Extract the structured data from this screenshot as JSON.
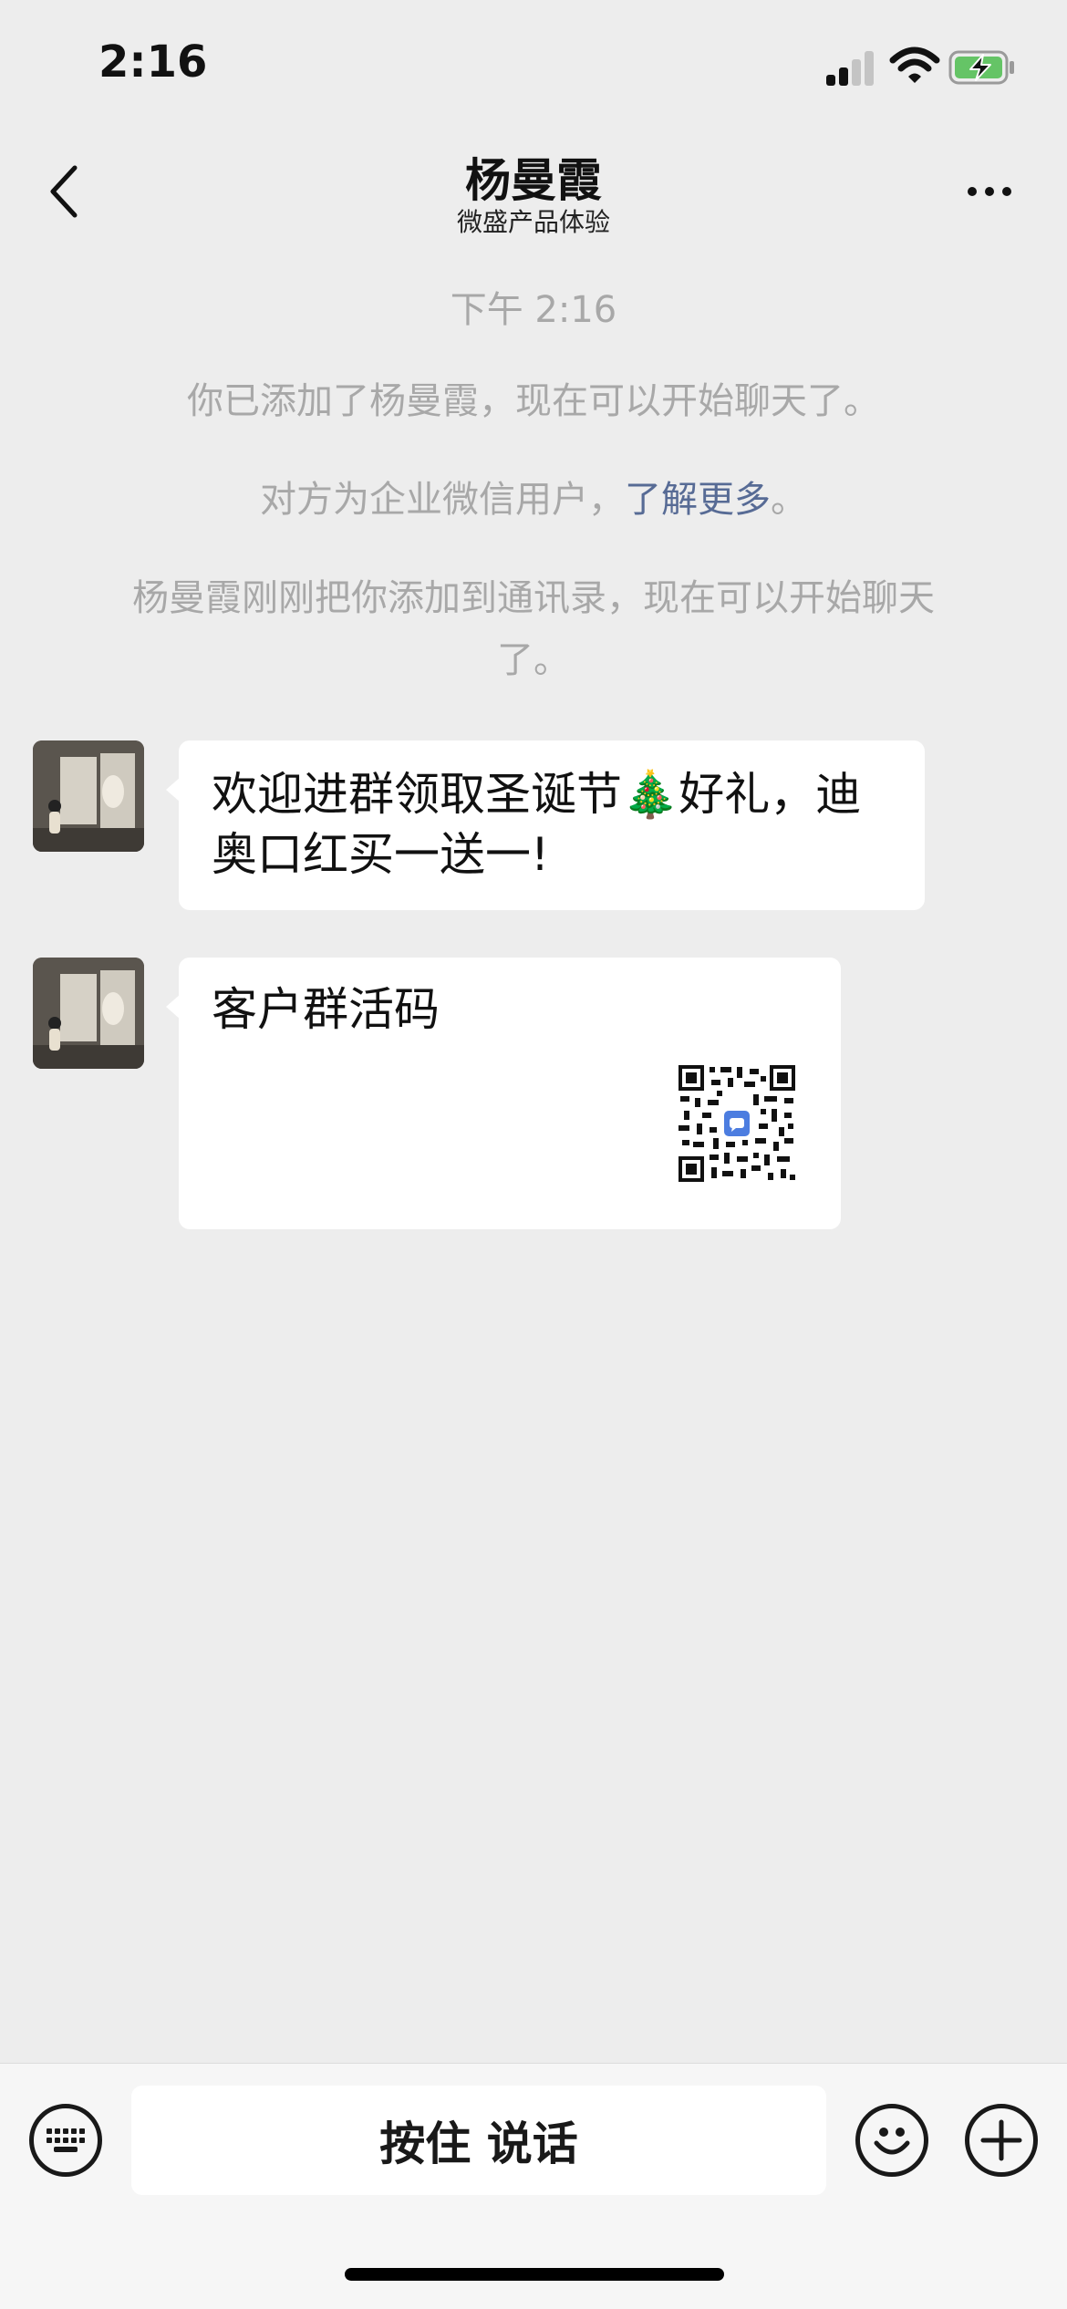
{
  "status_bar": {
    "time": "2:16",
    "icons": [
      "cellular-signal-icon",
      "wifi-icon",
      "battery-charging-icon"
    ],
    "battery_color": "#65c466"
  },
  "nav": {
    "back_icon": "chevron-left-icon",
    "title": "杨曼霞",
    "subtitle": "微盛产品体验",
    "more_icon": "more-dots-icon"
  },
  "system_messages": {
    "timestamp": "下午 2:16",
    "added_notice": "你已添加了杨曼霞，现在可以开始聊天了。",
    "enterprise_notice_prefix": "对方为企业微信用户，",
    "enterprise_notice_link": "了解更多",
    "enterprise_notice_suffix": "。",
    "contact_notice_line1": "杨曼霞刚刚把你添加到通讯录，现在可以开始聊天",
    "contact_notice_line2": "了。"
  },
  "messages": [
    {
      "sender": "杨曼霞",
      "type": "text",
      "line1": "欢迎进群领取圣诞节🎄好礼，迪",
      "line2": "奥口红买一送一!"
    },
    {
      "sender": "杨曼霞",
      "type": "qr-card",
      "title": "客户群活码",
      "qr_icon": "qr-code-icon"
    }
  ],
  "toolbar": {
    "keyboard_icon": "keyboard-icon",
    "hold_to_talk_label": "按住 说话",
    "emoji_icon": "smiley-icon",
    "plus_icon": "plus-icon"
  },
  "colors": {
    "background": "#ededed",
    "link": "#576b95",
    "system_text": "#a8a8a8",
    "bubble": "#ffffff"
  }
}
